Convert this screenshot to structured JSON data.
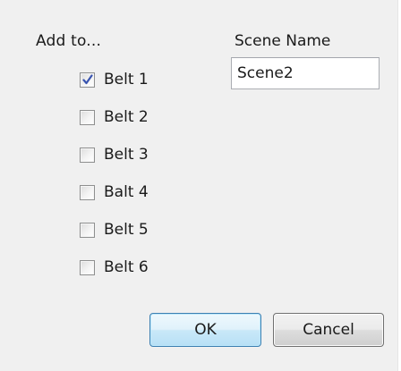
{
  "dialog": {
    "add_to_label": "Add to...",
    "belts": [
      {
        "label": "Belt 1",
        "checked": true
      },
      {
        "label": "Belt 2",
        "checked": false
      },
      {
        "label": "Belt 3",
        "checked": false
      },
      {
        "label": "Balt 4",
        "checked": false
      },
      {
        "label": "Belt 5",
        "checked": false
      },
      {
        "label": "Belt 6",
        "checked": false
      }
    ],
    "scene_name_label": "Scene Name",
    "scene_name_value": "Scene2",
    "ok_label": "OK",
    "cancel_label": "Cancel"
  },
  "colors": {
    "background": "#f0f0f0",
    "checkmark": "#3a55b0",
    "ok_border": "#3c7fb1"
  }
}
